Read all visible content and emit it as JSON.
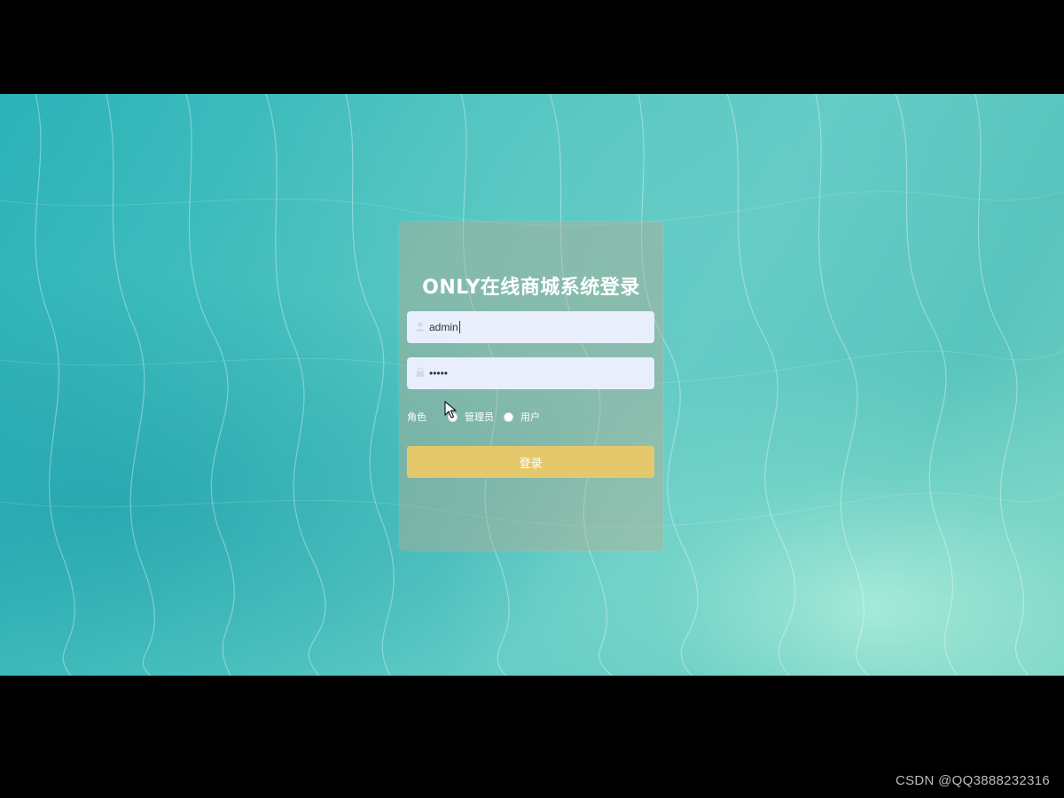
{
  "login": {
    "title": "ONLY在线商城系统登录",
    "username_value": "admin",
    "password_mask": "•••••",
    "role_label": "角色",
    "role_options": [
      "管理员",
      "用户"
    ],
    "submit_label": "登录"
  },
  "watermark": {
    "text": "CSDN @QQ3888232316"
  },
  "colors": {
    "card": "#bea98c",
    "input": "#e8eefb",
    "button": "#e5c86b",
    "background": "#4cc3c0"
  },
  "icons": {
    "username": "user-icon",
    "password": "lock-icon",
    "cursor": "mouse-pointer-icon"
  }
}
